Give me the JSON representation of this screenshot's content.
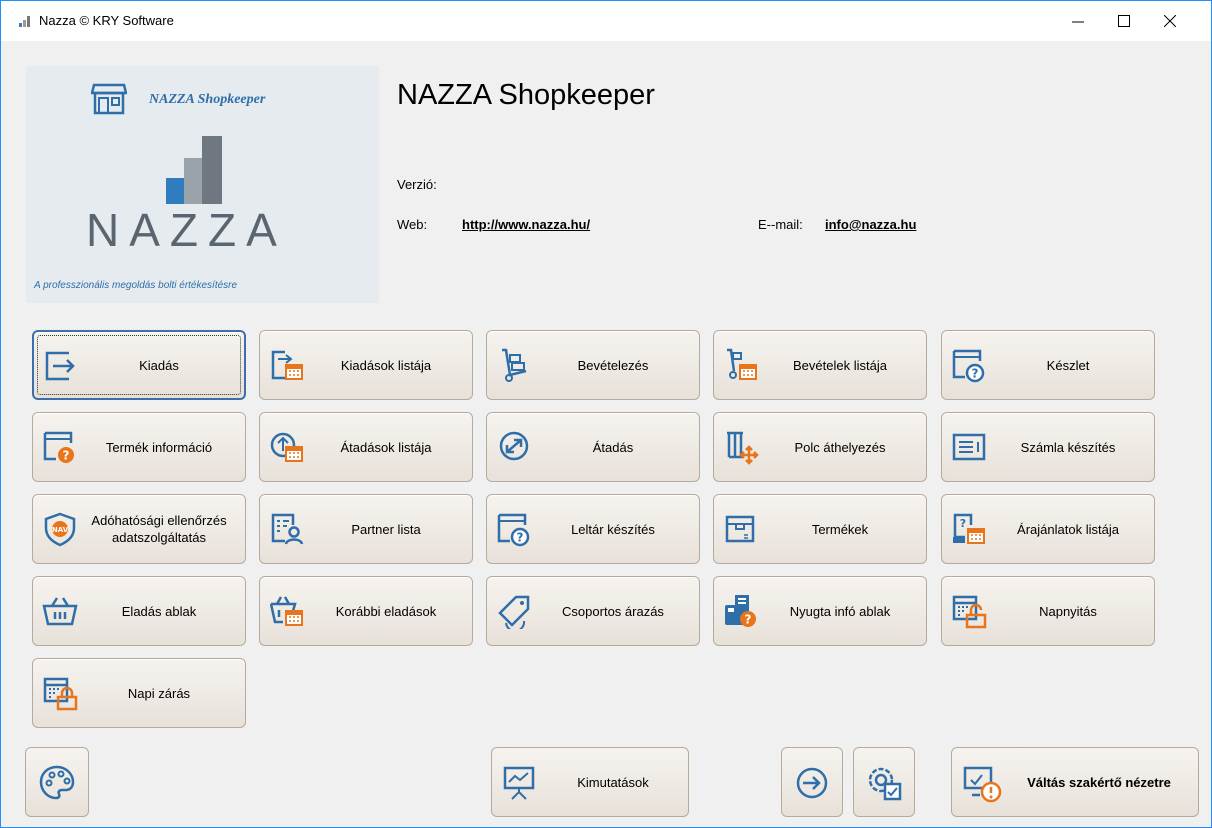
{
  "window": {
    "title": "Nazza © KRY Software"
  },
  "logo": {
    "title": "NAZZA Shopkeeper",
    "wordmark": "NAZZA",
    "tagline": "A professzionális megoldás bolti értékesítésre"
  },
  "info": {
    "heading": "NAZZA Shopkeeper",
    "version_label": "Verzió:",
    "web_label": "Web:",
    "web_link": "http://www.nazza.hu/",
    "email_label": "E--mail:",
    "email_link": "info@nazza.hu"
  },
  "buttons": [
    "Kiadás",
    "Kiadások listája",
    "Bevételezés",
    "Bevételek listája",
    "Készlet",
    "Termék információ",
    "Átadások listája",
    "Átadás",
    "Polc áthelyezés",
    "Számla készítés",
    "Adóhatósági ellenőrzés adatszolgáltatás",
    "Partner lista",
    "Leltár készítés",
    "Termékek",
    "Árajánlatok listája",
    "Eladás ablak",
    "Korábbi eladások",
    "Csoportos árazás",
    "Nyugta infó ablak",
    "Napnyitás",
    "Napi zárás"
  ],
  "bottom": {
    "stats_label": "Kimutatások",
    "expert_label": "Váltás szakértő nézetre"
  },
  "colors": {
    "accent": "#2f6ea8",
    "orange": "#e8741c",
    "border": "#b6aa9e"
  }
}
